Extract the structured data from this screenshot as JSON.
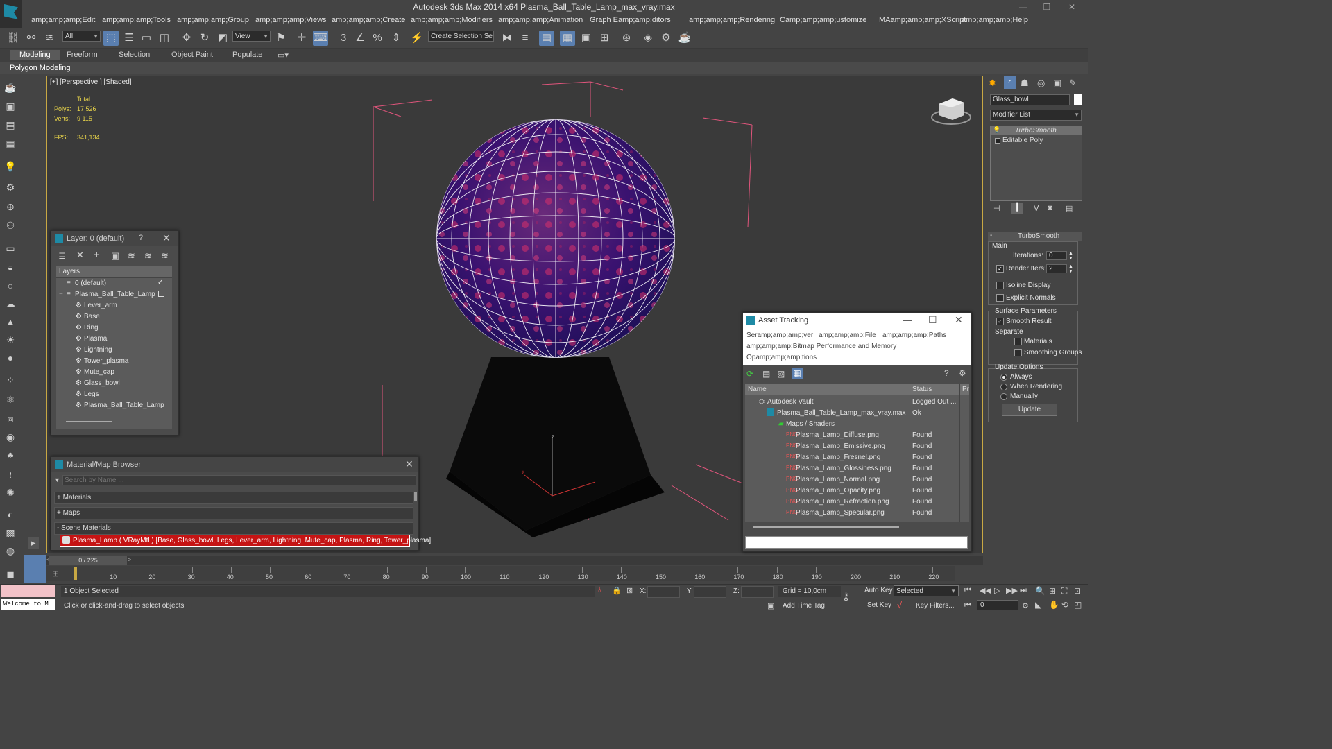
{
  "window": {
    "title": "Autodesk 3ds Max  2014 x64     Plasma_Ball_Table_Lamp_max_vray.max"
  },
  "menu": [
    "amp;amp;amp;Edit",
    "amp;amp;amp;Tools",
    "amp;amp;amp;Group",
    "amp;amp;amp;Views",
    "amp;amp;amp;Create",
    "amp;amp;amp;Modifiers",
    "amp;amp;amp;Animation",
    "Graph Eamp;amp;ditors",
    "amp;amp;amp;Rendering",
    "Camp;amp;amp;ustomize",
    "MAamp;amp;amp;XScript",
    "amp;amp;amp;Help"
  ],
  "toolbar": {
    "filter_select": "All",
    "view_select": "View",
    "selection_set": "Create Selection Se"
  },
  "ribbon": {
    "tabs": [
      "Modeling",
      "Freeform",
      "Selection",
      "Object Paint",
      "Populate"
    ],
    "subtitle": "Polygon Modeling"
  },
  "viewport": {
    "label": "[+] [Perspective ] [Shaded]",
    "stats": {
      "total": "Total",
      "polys_label": "Polys:",
      "polys_value": "17 526",
      "verts_label": "Verts:",
      "verts_value": "9 115",
      "fps_label": "FPS:",
      "fps_value": "341,134"
    }
  },
  "layer_panel": {
    "title": "Layer: 0 (default)",
    "help": "?",
    "header": "Layers",
    "items": [
      "0 (default)",
      "Plasma_Ball_Table_Lamp",
      "Lever_arm",
      "Base",
      "Ring",
      "Plasma",
      "Lightning",
      "Tower_plasma",
      "Mute_cap",
      "Glass_bowl",
      "Legs",
      "Plasma_Ball_Table_Lamp"
    ]
  },
  "material_browser": {
    "title": "Material/Map Browser",
    "search_placeholder": "Search by Name ...",
    "sections": [
      "+ Materials",
      "+ Maps",
      "- Scene Materials"
    ],
    "scene_material": "Plasma_Lamp  ( VRayMtl ) [Base, Glass_bowl, Legs, Lever_arm, Lightning, Mute_cap, Plasma, Ring, Tower_plasma]"
  },
  "asset_tracking": {
    "title": "Asset Tracking",
    "menu": [
      "Seramp;amp;amp;ver",
      "amp;amp;amp;File",
      "amp;amp;amp;Paths",
      "amp;amp;amp;Bitmap Performance and Memory",
      "Opamp;amp;amp;tions"
    ],
    "columns": [
      "Name",
      "Status",
      "Pr"
    ],
    "rows": [
      {
        "name": "Autodesk Vault",
        "status": "Logged Out ..."
      },
      {
        "name": "Plasma_Ball_Table_Lamp_max_vray.max",
        "status": "Ok"
      },
      {
        "name": "Maps / Shaders",
        "status": ""
      },
      {
        "name": "Plasma_Lamp_Diffuse.png",
        "status": "Found"
      },
      {
        "name": "Plasma_Lamp_Emissive.png",
        "status": "Found"
      },
      {
        "name": "Plasma_Lamp_Fresnel.png",
        "status": "Found"
      },
      {
        "name": "Plasma_Lamp_Glossiness.png",
        "status": "Found"
      },
      {
        "name": "Plasma_Lamp_Normal.png",
        "status": "Found"
      },
      {
        "name": "Plasma_Lamp_Opacity.png",
        "status": "Found"
      },
      {
        "name": "Plasma_Lamp_Refraction.png",
        "status": "Found"
      },
      {
        "name": "Plasma_Lamp_Specular.png",
        "status": "Found"
      }
    ]
  },
  "command_panel": {
    "object_name": "Glass_bowl",
    "modifier_list": "Modifier List",
    "stack": [
      "TurboSmooth",
      "Editable Poly"
    ],
    "turbosmooth": {
      "title": "TurboSmooth",
      "main": "Main",
      "iterations_label": "Iterations:",
      "iterations_value": "0",
      "render_iters_label": "Render Iters:",
      "render_iters_value": "2",
      "isoline": "Isoline Display",
      "explicit": "Explicit Normals",
      "surface": "Surface Parameters",
      "smooth_result": "Smooth Result",
      "separate": "Separate",
      "materials": "Materials",
      "smoothing_groups": "Smoothing Groups",
      "update_options": "Update Options",
      "always": "Always",
      "when_rendering": "When Rendering",
      "manually": "Manually",
      "update": "Update"
    }
  },
  "timeline": {
    "frame": "0 / 225",
    "ticks": [
      "10",
      "20",
      "30",
      "40",
      "50",
      "60",
      "70",
      "80",
      "90",
      "100",
      "110",
      "120",
      "130",
      "140",
      "150",
      "160",
      "170",
      "180",
      "190",
      "200",
      "210",
      "220"
    ]
  },
  "status": {
    "maxscript": "Welcome to M",
    "selected": "1 Object Selected",
    "prompt": "Click or click-and-drag to select objects",
    "x_label": "X:",
    "y_label": "Y:",
    "z_label": "Z:",
    "grid": "Grid = 10,0cm",
    "add_time_tag": "Add Time Tag",
    "auto_key": "Auto Key",
    "set_key": "Set Key",
    "selected_select": "Selected",
    "key_filters": "Key Filters...",
    "frame_value": "0"
  }
}
